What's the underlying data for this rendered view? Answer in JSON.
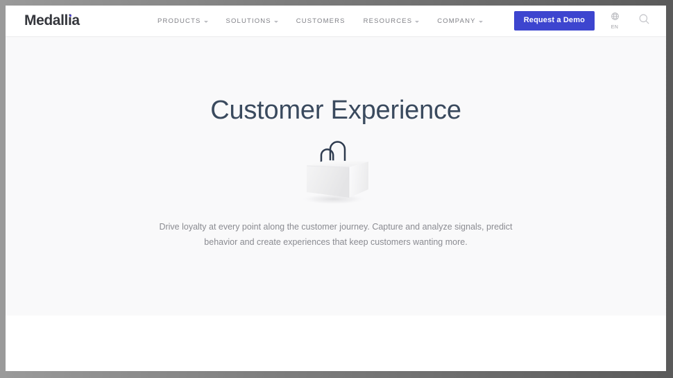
{
  "brand": {
    "logo_text": "Medallia",
    "accent_color": "#4a3fd4"
  },
  "header": {
    "nav_items": [
      {
        "label": "PRODUCTS",
        "has_dropdown": true
      },
      {
        "label": "SOLUTIONS",
        "has_dropdown": true
      },
      {
        "label": "CUSTOMERS",
        "has_dropdown": false
      },
      {
        "label": "RESOURCES",
        "has_dropdown": true
      },
      {
        "label": "COMPANY",
        "has_dropdown": true
      }
    ],
    "demo_button_label": "Request a Demo",
    "demo_button_color": "#3d45cf",
    "language_code": "EN",
    "language_icon": "globe-icon",
    "search_icon": "search-icon"
  },
  "hero": {
    "title": "Customer Experience",
    "title_color": "#3a4a5e",
    "illustration": "shopping-bag-illustration",
    "body_line_1": "Drive loyalty at every point along the customer journey. Capture and analyze signals, predict",
    "body_line_2": "behavior and create experiences that keep customers wanting more.",
    "body_text": "Drive loyalty at every point along the customer journey. Capture and analyze signals, predict behavior and create experiences that keep customers wanting more.",
    "background_color": "#f9f9fa"
  }
}
